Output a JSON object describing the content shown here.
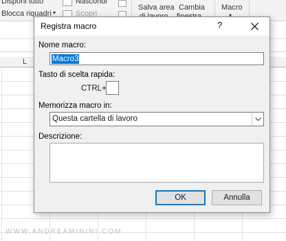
{
  "ribbon": {
    "row1_left": "Disponi tutto",
    "hide": "Nascondi",
    "block_panes": "Blocca riquadri",
    "scopri": "Scopri",
    "save_area_line1": "Salva area",
    "save_area_line2": "di lavoro",
    "change_window_line1": "Cambia",
    "change_window_line2": "finestra",
    "macro": "Macro"
  },
  "spreadsheet": {
    "column_label": "L"
  },
  "watermark": "WWW.ANDREAMININI.COM",
  "dialog": {
    "title": "Registra macro",
    "help": "?",
    "name_label": "Nome macro:",
    "name_value": "Macro3",
    "shortcut_label": "Tasto di scelta rapida:",
    "ctrl_label": "CTRL+",
    "shortcut_value": "",
    "store_label": "Memorizza macro in:",
    "store_value": "Questa cartella di lavoro",
    "description_label": "Descrizione:",
    "description_value": "",
    "ok": "OK",
    "cancel": "Annulla"
  }
}
